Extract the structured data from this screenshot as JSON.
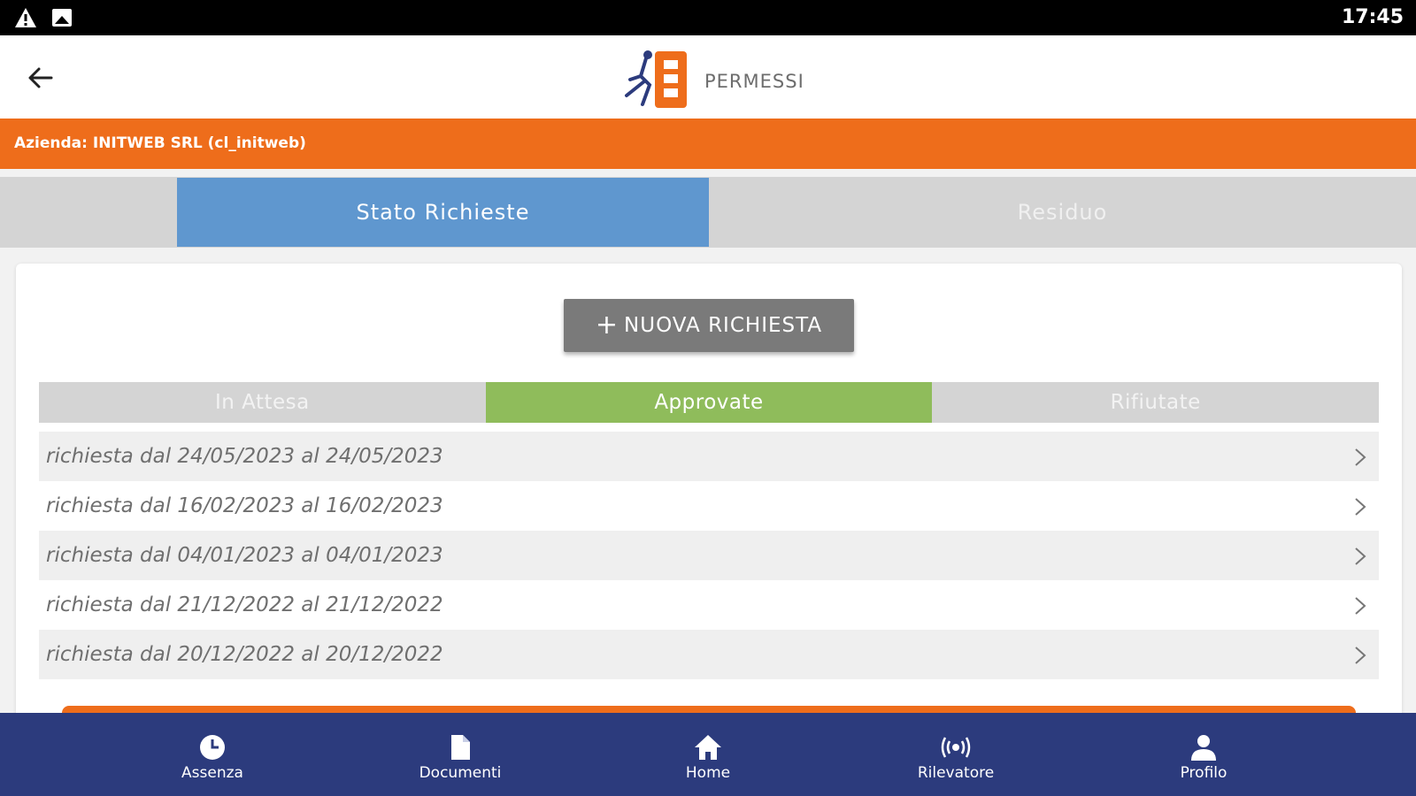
{
  "status_bar": {
    "time": "17:45"
  },
  "header": {
    "title": "PERMESSI"
  },
  "company": {
    "label": "Azienda: INITWEB SRL (cl_initweb)"
  },
  "main_tabs": [
    {
      "label": "Stato Richieste",
      "active": true
    },
    {
      "label": "Residuo",
      "active": false
    }
  ],
  "new_request_button": {
    "icon": "+",
    "label": "NUOVA RICHIESTA"
  },
  "status_tabs": [
    {
      "label": "In Attesa",
      "active": false
    },
    {
      "label": "Approvate",
      "active": true
    },
    {
      "label": "Rifiutate",
      "active": false
    }
  ],
  "requests": [
    "richiesta dal 24/05/2023 al 24/05/2023",
    "richiesta dal 16/02/2023 al 16/02/2023",
    "richiesta dal 04/01/2023 al 04/01/2023",
    "richiesta dal 21/12/2022 al 21/12/2022",
    "richiesta dal 20/12/2022 al 20/12/2022"
  ],
  "bottom_nav": [
    {
      "label": "Assenza",
      "icon": "clock-icon"
    },
    {
      "label": "Documenti",
      "icon": "document-icon"
    },
    {
      "label": "Home",
      "icon": "home-icon"
    },
    {
      "label": "Rilevatore",
      "icon": "broadcast-icon"
    },
    {
      "label": "Profilo",
      "icon": "user-icon"
    }
  ],
  "colors": {
    "accent_orange": "#ee6d1b",
    "active_tab_blue": "#5f97cf",
    "approved_green": "#8fbc5b",
    "nav_blue": "#2c3b7d"
  }
}
